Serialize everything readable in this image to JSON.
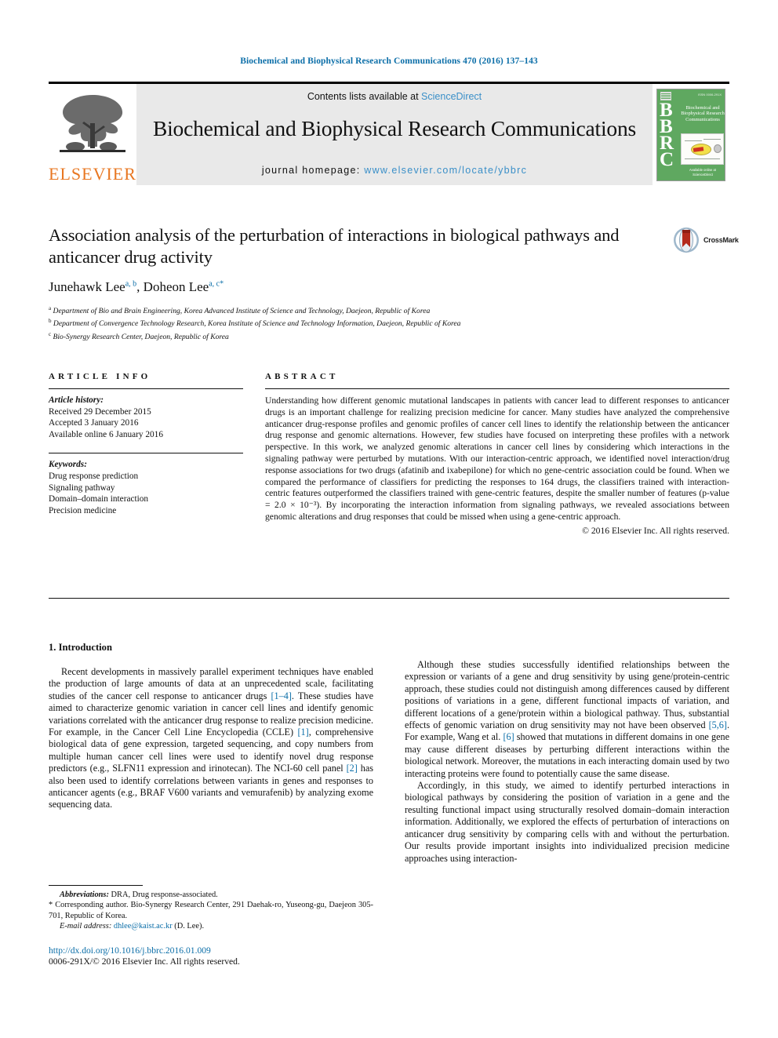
{
  "running_head": "Biochemical and Biophysical Research Communications 470 (2016) 137–143",
  "masthead": {
    "publisher": "ELSEVIER",
    "contents_prefix": "Contents lists available at ",
    "contents_link": "ScienceDirect",
    "journal_title": "Biochemical and Biophysical Research Communications",
    "homepage_prefix": "journal homepage: ",
    "homepage_url": "www.elsevier.com/locate/ybbrc",
    "cover": {
      "letters": "BBRC",
      "title": "Biochemical and Biophysical Research Communications",
      "footer": "Available online at ScienceDirect"
    }
  },
  "article": {
    "title": "Association analysis of the perturbation of interactions in biological pathways and anticancer drug activity",
    "authors_plain": "Junehawk Lee a, b, Doheon Lee a, c, *",
    "authors": [
      {
        "name": "Junehawk Lee",
        "marks": "a, b",
        "star": false
      },
      {
        "name": "Doheon Lee",
        "marks": "a, c",
        "star": true
      }
    ],
    "affiliations": [
      {
        "mark": "a",
        "text": "Department of Bio and Brain Engineering, Korea Advanced Institute of Science and Technology, Daejeon, Republic of Korea"
      },
      {
        "mark": "b",
        "text": "Department of Convergence Technology Research, Korea Institute of Science and Technology Information, Daejeon, Republic of Korea"
      },
      {
        "mark": "c",
        "text": "Bio-Synergy Research Center, Daejeon, Republic of Korea"
      }
    ],
    "crossmark_label": "CrossMark"
  },
  "article_info": {
    "heading": "ARTICLE INFO",
    "history_label": "Article history:",
    "history": [
      "Received 29 December 2015",
      "Accepted 3 January 2016",
      "Available online 6 January 2016"
    ],
    "keywords_label": "Keywords:",
    "keywords": [
      "Drug response prediction",
      "Signaling pathway",
      "Domain–domain interaction",
      "Precision medicine"
    ]
  },
  "abstract": {
    "heading": "ABSTRACT",
    "text": "Understanding how different genomic mutational landscapes in patients with cancer lead to different responses to anticancer drugs is an important challenge for realizing precision medicine for cancer. Many studies have analyzed the comprehensive anticancer drug-response profiles and genomic profiles of cancer cell lines to identify the relationship between the anticancer drug response and genomic alternations. However, few studies have focused on interpreting these profiles with a network perspective. In this work, we analyzed genomic alterations in cancer cell lines by considering which interactions in the signaling pathway were perturbed by mutations. With our interaction-centric approach, we identified novel interaction/drug response associations for two drugs (afatinib and ixabepilone) for which no gene-centric association could be found. When we compared the performance of classifiers for predicting the responses to 164 drugs, the classifiers trained with interaction-centric features outperformed the classifiers trained with gene-centric features, despite the smaller number of features (p-value = 2.0 × 10⁻³). By incorporating the interaction information from signaling pathways, we revealed associations between genomic alterations and drug responses that could be missed when using a gene-centric approach.",
    "copyright": "© 2016 Elsevier Inc. All rights reserved."
  },
  "introduction": {
    "heading": "1. Introduction",
    "left_p1_a": "Recent developments in massively parallel experiment techniques have enabled the production of large amounts of data at an unprecedented scale, facilitating studies of the cancer cell response to anticancer drugs ",
    "left_ref1": "[1–4]",
    "left_p1_b": ". These studies have aimed to characterize genomic variation in cancer cell lines and identify genomic variations correlated with the anticancer drug response to realize precision medicine. For example, in the Cancer Cell Line Encyclopedia (CCLE) ",
    "left_ref2": "[1]",
    "left_p1_c": ", comprehensive biological data of gene expression, targeted sequencing, and copy numbers from multiple human cancer cell lines were used to identify novel drug response predictors (e.g., SLFN11 expression and irinotecan). The NCI-60 cell panel ",
    "left_ref3": "[2]",
    "left_p1_d": " has also been used to identify correlations between variants in genes and responses to anticancer agents (e.g., BRAF V600 variants and vemurafenib) by analyzing exome sequencing data.",
    "right_p1_a": "Although these studies successfully identified relationships between the expression or variants of a gene and drug sensitivity by using gene/protein-centric approach, these studies could not distinguish among differences caused by different positions of variations in a gene, different functional impacts of variation, and different locations of a gene/protein within a biological pathway. Thus, substantial effects of genomic variation on drug sensitivity may not have been observed ",
    "right_ref1": "[5,6]",
    "right_p1_b": ". For example, Wang et al. ",
    "right_ref2": "[6]",
    "right_p1_c": " showed that mutations in different domains in one gene may cause different diseases by perturbing different interactions within the biological network. Moreover, the mutations in each interacting domain used by two interacting proteins were found to potentially cause the same disease.",
    "right_p2": "Accordingly, in this study, we aimed to identify perturbed interactions in biological pathways by considering the position of variation in a gene and the resulting functional impact using structurally resolved domain–domain interaction information. Additionally, we explored the effects of perturbation of interactions on anticancer drug sensitivity by comparing cells with and without the perturbation. Our results provide important insights into individualized precision medicine approaches using interaction-"
  },
  "footnotes": {
    "abbrev_label": "Abbreviations:",
    "abbrev_text": " DRA, Drug response-associated.",
    "corresponding": "* Corresponding author. Bio-Synergy Research Center, 291 Daehak-ro, Yuseong-gu, Daejeon 305-701, Republic of Korea.",
    "email_label": "E-mail address:",
    "email": "dhlee@kaist.ac.kr",
    "email_suffix": " (D. Lee)."
  },
  "footer": {
    "doi": "http://dx.doi.org/10.1016/j.bbrc.2016.01.009",
    "issn": "0006-291X/© 2016 Elsevier Inc. All rights reserved."
  },
  "colors": {
    "link_blue": "#0b6ea8",
    "elsevier_orange": "#E87722",
    "cover_green": "#5fa860",
    "masthead_gray": "#e9e9e9"
  }
}
